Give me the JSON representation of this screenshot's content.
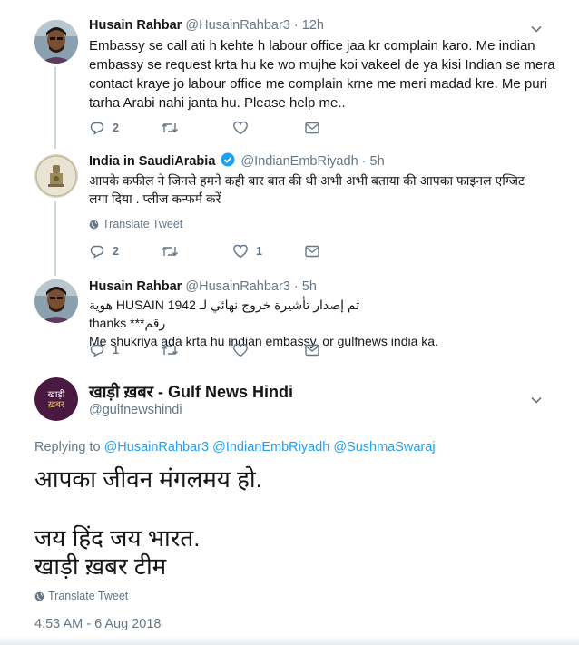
{
  "tweets": [
    {
      "name": "Husain Rahbar",
      "handle": "@HusainRahbar3",
      "dot": "·",
      "time": "12h",
      "lines": [
        "Embassy se call ati h kehte h labour office jaa kr complain karo. Me indian",
        "embassy se request krta hu ke wo mujhe koi vakeel de ya kisi Indian se mera",
        "contact kraye jo labour office me complain krne me meri madad kre. Me puri",
        "tarha Arabi nahi janta hu. Please help me.."
      ],
      "actions": {
        "replies": "2",
        "retweets": "",
        "likes": ""
      }
    },
    {
      "name": "India in SaudiArabia",
      "handle": "@IndianEmbRiyadh",
      "dot": "·",
      "time": "5h",
      "lines": [
        "आपके कफील ने जिनसे हमने कही बार बात की थी अभी अभी बताया की आपका फाइनल एग्जिट",
        "लगा दिया . प्लीज कन्फर्म करें"
      ],
      "translate": "Translate Tweet",
      "actions": {
        "replies": "2",
        "retweets": "",
        "likes": "1"
      }
    },
    {
      "name": "Husain Rahbar",
      "handle": "@HusainRahbar3",
      "dot": "·",
      "time": "5h",
      "lines": [
        "تم إصدار تأشيرة خروج نهائي لـ HUSAIN 1942 هوية رقم*** thanks",
        "Me shukriya ada krta hu indian embassy, or gulfnews india ka."
      ],
      "actions": {
        "replies": "1",
        "retweets": "",
        "likes": ""
      }
    }
  ],
  "main": {
    "avatar_text_1": "खाड़ी",
    "avatar_text_2": "ख़बर",
    "name": "खाड़ी ख़बर - Gulf News Hindi",
    "handle": "@gulfnewshindi",
    "replying_prefix": "Replying to",
    "replying_to": [
      "@HusainRahbar3",
      "@IndianEmbRiyadh",
      "@SushmaSwaraj"
    ],
    "lines": [
      "आपका जीवन मंगलमय हो.",
      "जय हिंद जय भारत.",
      "खाड़ी ख़बर टीम"
    ],
    "translate": "Translate Tweet",
    "timestamp": "4:53 AM - 6 Aug 2018"
  },
  "colors": {
    "accent": "#1da1f2",
    "muted": "#657786",
    "thread_line": "#ccd6dd",
    "main_avatar_bg": "#4a1942"
  },
  "icons": [
    "reply-icon",
    "retweet-icon",
    "like-icon",
    "dm-icon",
    "chevron-down-icon",
    "verified-icon",
    "globe-icon"
  ]
}
